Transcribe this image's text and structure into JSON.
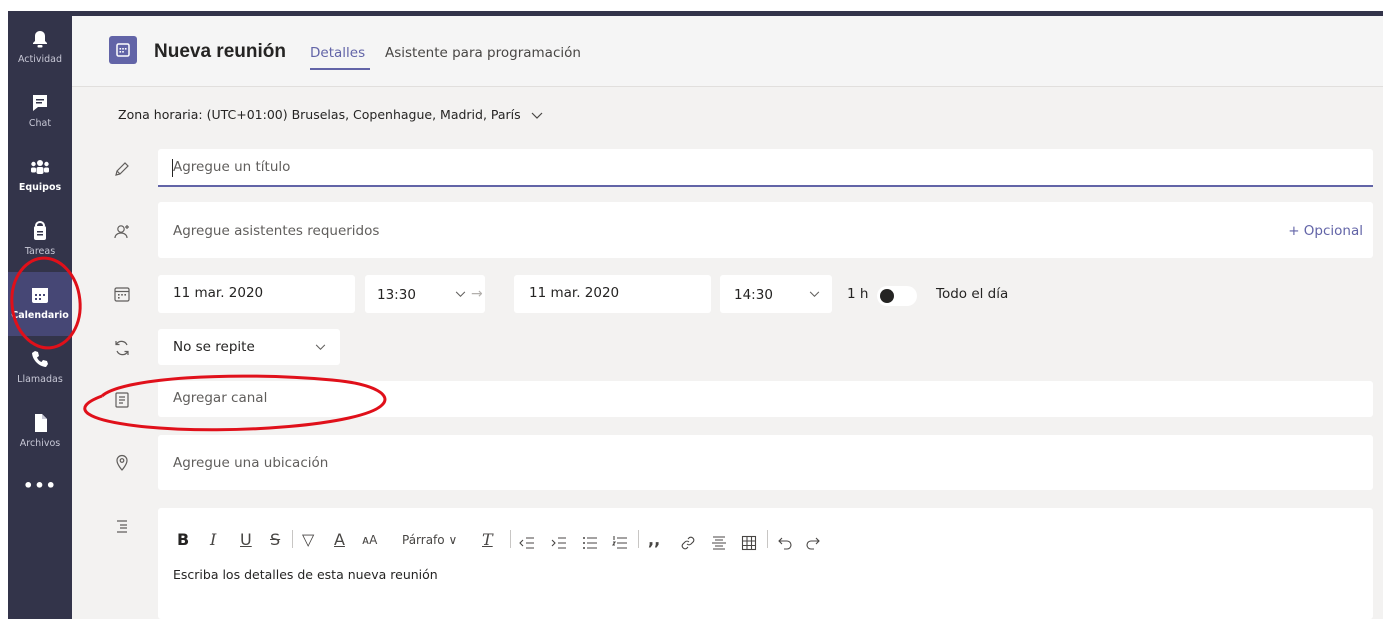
{
  "rail": {
    "items": [
      {
        "label": "Actividad",
        "icon": "bell-icon"
      },
      {
        "label": "Chat",
        "icon": "chat-icon"
      },
      {
        "label": "Equipos",
        "icon": "teams-icon"
      },
      {
        "label": "Tareas",
        "icon": "tasks-icon"
      },
      {
        "label": "Calendario",
        "icon": "calendar-icon"
      },
      {
        "label": "Llamadas",
        "icon": "phone-icon"
      },
      {
        "label": "Archivos",
        "icon": "file-icon"
      }
    ],
    "more": "•••",
    "accent": "#464775"
  },
  "header": {
    "title": "Nueva reunión",
    "tabs": [
      {
        "label": "Detalles"
      },
      {
        "label": "Asistente para programación"
      }
    ]
  },
  "timezone": "Zona horaria: (UTC+01:00) Bruselas, Copenhague, Madrid, París",
  "form": {
    "title_placeholder": "Agregue un título",
    "attendees_placeholder": "Agregue asistentes requeridos",
    "optional_link": "+ Opcional",
    "start_date": "11 mar. 2020",
    "start_time": "13:30",
    "end_date": "11 mar. 2020",
    "end_time": "14:30",
    "duration": "1 h",
    "all_day": "Todo el día",
    "repeat": "No se repite",
    "channel_placeholder": "Agregar canal",
    "location_placeholder": "Agregue una ubicación",
    "paragraph_label": "Párrafo",
    "details_placeholder": "Escriba los detalles de esta nueva reunión"
  },
  "colors": {
    "brand": "#6264a7",
    "annotation": "#e0101a"
  }
}
